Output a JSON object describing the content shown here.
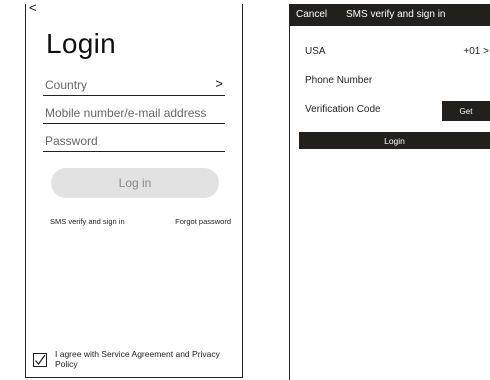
{
  "login": {
    "back_icon": "back-chevron-icon",
    "title": "Login",
    "country_placeholder": "Country",
    "country_chevron": "chevron-right-icon",
    "mobile_placeholder": "Mobile number/e-mail address",
    "password_placeholder": "Password",
    "login_button": "Log in",
    "sms_link": "SMS verify and sign in",
    "forgot_link": "Forgot password",
    "agree_checked": true,
    "agree_text": "I agree with Service Agreement and Privacy Policy"
  },
  "sms": {
    "cancel": "Cancel",
    "title": "SMS verify and sign in",
    "country": "USA",
    "country_code": "+01",
    "phone_label": "Phone Number",
    "code_label": "Verification Code",
    "get_button": "Get",
    "login_button": "Login",
    "accent_color": "#231f1d"
  }
}
